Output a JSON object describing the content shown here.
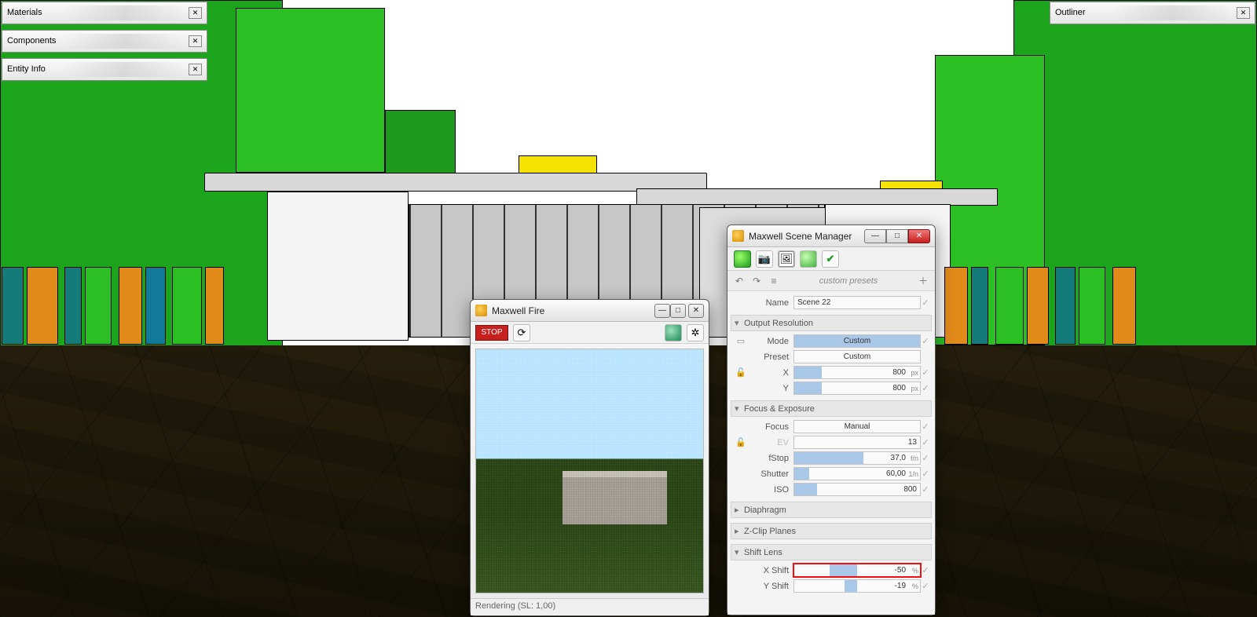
{
  "side_panels": {
    "materials": "Materials",
    "components": "Components",
    "entity_info": "Entity Info",
    "outliner": "Outliner"
  },
  "fire": {
    "title": "Maxwell Fire",
    "stop": "STOP",
    "status": "Rendering (SL: 1,00)"
  },
  "msm": {
    "title": "Maxwell Scene Manager",
    "presets_placeholder": "custom presets",
    "name_label": "Name",
    "name_value": "Scene 22",
    "sections": {
      "output": "Output Resolution",
      "focus": "Focus & Exposure",
      "diaphragm": "Diaphragm",
      "zclip": "Z-Clip Planes",
      "shift": "Shift Lens"
    },
    "output": {
      "mode_label": "Mode",
      "mode_value": "Custom",
      "preset_label": "Preset",
      "preset_value": "Custom",
      "x_label": "X",
      "x_value": "800",
      "x_unit": "px",
      "y_label": "Y",
      "y_value": "800",
      "y_unit": "px"
    },
    "focus": {
      "focus_label": "Focus",
      "focus_value": "Manual",
      "ev_label": "EV",
      "ev_value": "13",
      "fstop_label": "fStop",
      "fstop_value": "37,0",
      "fstop_unit": "f/n",
      "shutter_label": "Shutter",
      "shutter_value": "60,00",
      "shutter_unit": "1/n",
      "iso_label": "ISO",
      "iso_value": "800"
    },
    "shift": {
      "x_label": "X Shift",
      "x_value": "-50",
      "x_unit": "%",
      "y_label": "Y Shift",
      "y_value": "-19",
      "y_unit": "%"
    }
  }
}
